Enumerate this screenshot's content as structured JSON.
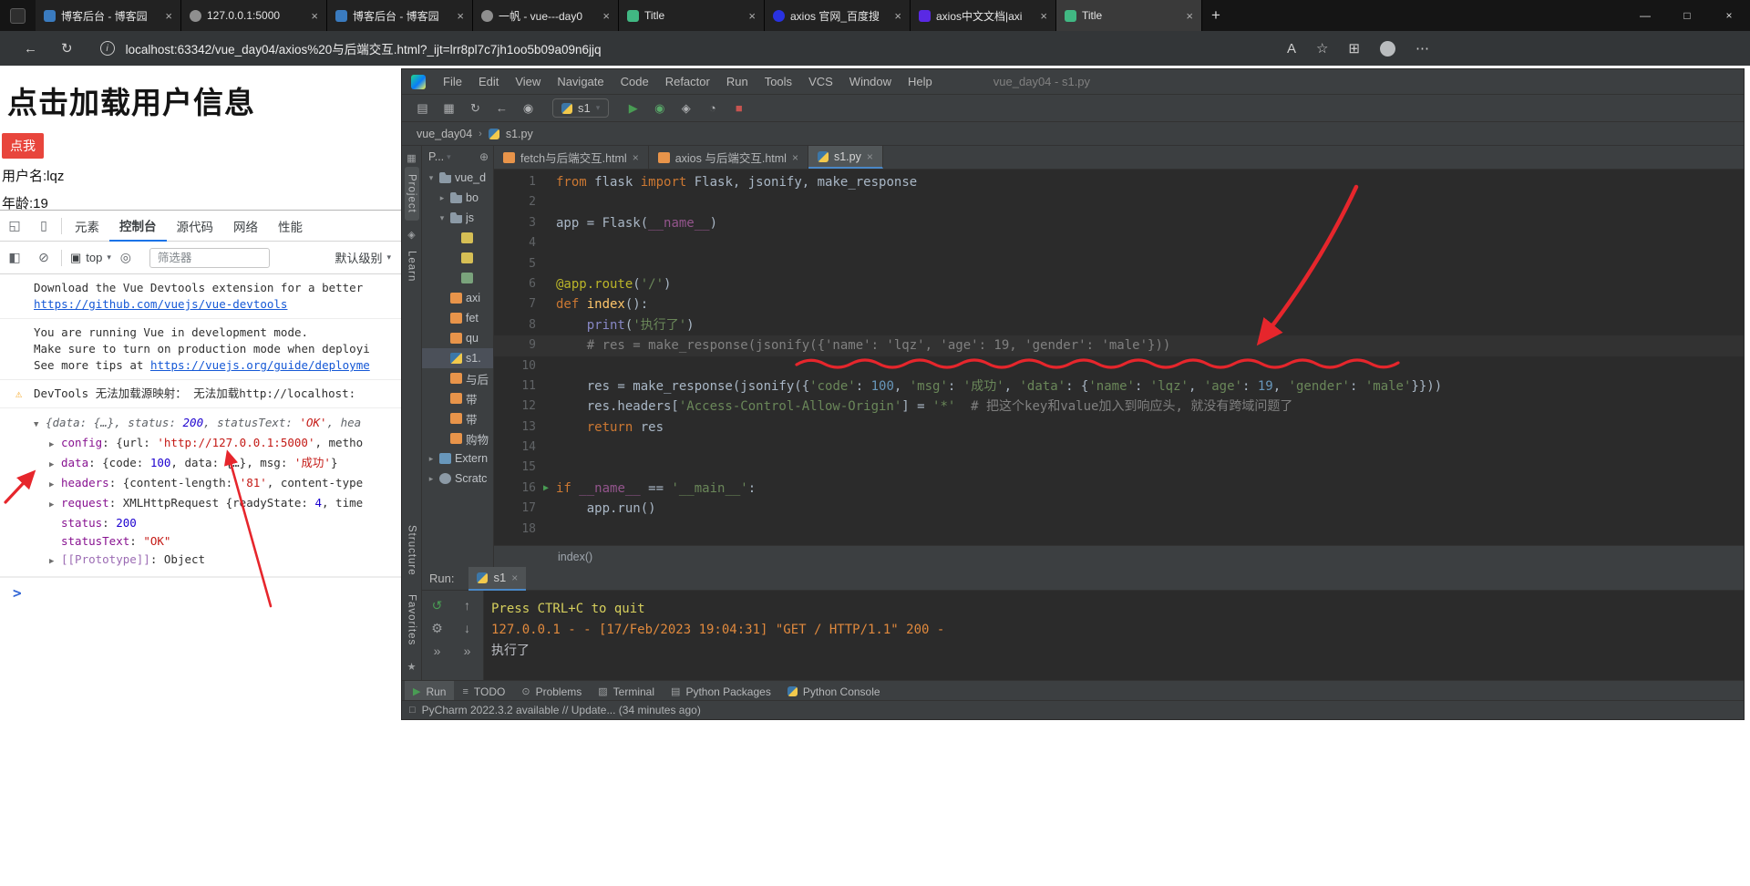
{
  "colors": {
    "annotation_red": "#e6262c",
    "button_red": "#e8453c",
    "devtools_accent": "#1a73e8",
    "run_green": "#499c54",
    "stop_red": "#c75450"
  },
  "icons": {
    "new_tab": "+",
    "minimize": "—",
    "maximize": "□",
    "close": "×",
    "close_small": "×",
    "back": "←",
    "refresh": "↻",
    "info": "i",
    "read_aloud": "A",
    "favorites": "☆",
    "collections": "⊞",
    "more": "⋯",
    "inspect": "◱",
    "device": "▯",
    "panel": "◧",
    "clear": "⊘",
    "frame": "▣",
    "eye": "◎",
    "caret": "▾",
    "chevron": "›",
    "target": "⊕",
    "open": "▤",
    "save": "▦",
    "sync": "↻",
    "user": "◉",
    "run": "▶",
    "debug": "◉",
    "coverage": "◈",
    "profiler": "◔",
    "stop": "■",
    "rerun": "↺",
    "up": "↑",
    "settings": "⚙",
    "down": "↓",
    "expand": "»",
    "todo": "≡",
    "problems": "⊙",
    "terminal": "▨",
    "packages": "▤",
    "status": "□",
    "warning": "⚠",
    "star": "★",
    "learn": "◈",
    "grid": "▦",
    "run_line": "▶"
  },
  "browser": {
    "tabs": [
      {
        "label": "博客后台 - 博客园",
        "icon": "cnblogs"
      },
      {
        "label": "127.0.0.1:5000",
        "icon": "generic"
      },
      {
        "label": "博客后台 - 博客园",
        "icon": "cnblogs"
      },
      {
        "label": "一帆 - vue---day0",
        "icon": "generic"
      },
      {
        "label": "Title",
        "icon": "vue"
      },
      {
        "label": "axios 官网_百度搜",
        "icon": "baidu"
      },
      {
        "label": "axios中文文档|axi",
        "icon": "axios"
      },
      {
        "label": "Title",
        "icon": "vue",
        "active": true
      }
    ],
    "window_controls": [
      "minimize",
      "maximize",
      "close"
    ],
    "address": {
      "url": "localhost:63342/vue_day04/axios%20与后端交互.html?_ijt=lrr8pl7c7jh1oo5b09a09n6jjq"
    }
  },
  "page": {
    "heading": "点击加载用户信息",
    "load_button": "点我",
    "username_line": "用户名:lqz",
    "age_line": "年龄:19"
  },
  "devtools": {
    "tabs": [
      {
        "label": "元素"
      },
      {
        "label": "控制台",
        "active": true
      },
      {
        "label": "源代码"
      },
      {
        "label": "网络"
      },
      {
        "label": "性能"
      }
    ],
    "context_selector": "top",
    "filter_placeholder": "筛选器",
    "log_level": "默认级别",
    "console": {
      "prompt": ">",
      "messages": [
        {
          "type": "log",
          "lines": [
            [
              [
                "pl",
                "Download the Vue Devtools extension for a better"
              ]
            ],
            [
              [
                "link",
                "https://github.com/vuejs/vue-devtools"
              ]
            ]
          ]
        },
        {
          "type": "log",
          "lines": [
            [
              [
                "pl",
                "You are running Vue in development mode."
              ]
            ],
            [
              [
                "pl",
                "Make sure to turn on production mode when deployi"
              ]
            ],
            [
              [
                "pl",
                "See more tips at "
              ],
              [
                "link",
                "https://vuejs.org/guide/deployme"
              ]
            ]
          ]
        },
        {
          "type": "warning",
          "lines": [
            [
              [
                "pl",
                "DevTools 无法加载源映射： 无法加载http://localhost:"
              ]
            ]
          ]
        },
        {
          "type": "tree",
          "rows": [
            {
              "a": "▼",
              "indent": 0,
              "tk": [
                [
                  "prev",
                  "{data: {…}, status: "
                ],
                [
                  "prevnum",
                  "200"
                ],
                [
                  "prev",
                  ", statusText: "
                ],
                [
                  "prevstr",
                  "'OK'"
                ],
                [
                  "prev",
                  ", hea"
                ]
              ]
            },
            {
              "a": "▶",
              "indent": 1,
              "tk": [
                [
                  "key",
                  "config"
                ],
                [
                  "pl",
                  ": {url: "
                ],
                [
                  "str",
                  "'http://127.0.0.1:5000'"
                ],
                [
                  "pl",
                  ", metho"
                ]
              ]
            },
            {
              "a": "▶",
              "indent": 1,
              "tk": [
                [
                  "key",
                  "data"
                ],
                [
                  "pl",
                  ": {code: "
                ],
                [
                  "num",
                  "100"
                ],
                [
                  "pl",
                  ", data: {…}, msg: "
                ],
                [
                  "str",
                  "'成功'"
                ],
                [
                  "pl",
                  "}"
                ]
              ]
            },
            {
              "a": "▶",
              "indent": 1,
              "tk": [
                [
                  "key",
                  "headers"
                ],
                [
                  "pl",
                  ": {content-length: "
                ],
                [
                  "str",
                  "'81'"
                ],
                [
                  "pl",
                  ", content-type"
                ]
              ]
            },
            {
              "a": "▶",
              "indent": 1,
              "tk": [
                [
                  "key",
                  "request"
                ],
                [
                  "pl",
                  ": XMLHttpRequest {readyState: "
                ],
                [
                  "num",
                  "4"
                ],
                [
                  "pl",
                  ", time"
                ]
              ]
            },
            {
              "a": "",
              "indent": 1,
              "tk": [
                [
                  "key",
                  "status"
                ],
                [
                  "pl",
                  ": "
                ],
                [
                  "num",
                  "200"
                ]
              ]
            },
            {
              "a": "",
              "indent": 1,
              "tk": [
                [
                  "key",
                  "statusText"
                ],
                [
                  "pl",
                  ": "
                ],
                [
                  "str",
                  "\"OK\""
                ]
              ]
            },
            {
              "a": "▶",
              "indent": 1,
              "tk": [
                [
                  "keydim",
                  "[[Prototype]]"
                ],
                [
                  "pl",
                  ": "
                ],
                [
                  "pl",
                  "Object"
                ]
              ]
            }
          ]
        }
      ]
    }
  },
  "pycharm": {
    "title": "vue_day04 - s1.py",
    "menus": [
      "File",
      "Edit",
      "View",
      "Navigate",
      "Code",
      "Refactor",
      "Run",
      "Tools",
      "VCS",
      "Window",
      "Help"
    ],
    "toolbar_left": [
      "open",
      "save",
      "sync",
      "back",
      "user"
    ],
    "toolbar_right": [
      "run",
      "debug",
      "coverage",
      "profiler",
      "stop"
    ],
    "run_config": "s1",
    "breadcrumbs": [
      "vue_day04",
      "s1.py"
    ],
    "tool_strip": [
      "Project",
      "Learn"
    ],
    "tool_strip_bottom": [
      "Structure",
      "Favorites"
    ],
    "project_panel": {
      "header": "P...",
      "items": [
        {
          "label": "vue_d",
          "indent": 0,
          "arrow": "▾",
          "icon": "folder"
        },
        {
          "label": "bo",
          "indent": 1,
          "arrow": "▸",
          "icon": "folder"
        },
        {
          "label": "js",
          "indent": 1,
          "arrow": "▾",
          "icon": "folder"
        },
        {
          "label": "",
          "indent": 2,
          "arrow": "",
          "icon": "js"
        },
        {
          "label": "",
          "indent": 2,
          "arrow": "",
          "icon": "js"
        },
        {
          "label": "",
          "indent": 2,
          "arrow": "",
          "icon": "img"
        },
        {
          "label": "axi",
          "indent": 1,
          "arrow": "",
          "icon": "html"
        },
        {
          "label": "fet",
          "indent": 1,
          "arrow": "",
          "icon": "html"
        },
        {
          "label": "qu",
          "indent": 1,
          "arrow": "",
          "icon": "html"
        },
        {
          "label": "s1.",
          "indent": 1,
          "arrow": "",
          "icon": "py",
          "selected": true
        },
        {
          "label": "与后",
          "indent": 1,
          "arrow": "",
          "icon": "html"
        },
        {
          "label": "带",
          "indent": 1,
          "arrow": "",
          "icon": "html"
        },
        {
          "label": "带",
          "indent": 1,
          "arrow": "",
          "icon": "html"
        },
        {
          "label": "购物",
          "indent": 1,
          "arrow": "",
          "icon": "html"
        },
        {
          "label": "Extern",
          "indent": 0,
          "arrow": "▸",
          "icon": "lib"
        },
        {
          "label": "Scratc",
          "indent": 0,
          "arrow": "▸",
          "icon": "scratch"
        }
      ]
    },
    "editor_tabs": [
      {
        "label": "fetch与后端交互.html",
        "icon": "html"
      },
      {
        "label": "axios 与后端交互.html",
        "icon": "html"
      },
      {
        "label": "s1.py",
        "icon": "py",
        "active": true
      }
    ],
    "code": [
      {
        "n": 1,
        "t": [
          [
            "kw",
            "from"
          ],
          [
            "pl",
            " flask "
          ],
          [
            "kw",
            "import"
          ],
          [
            "pl",
            " Flask, jsonify, make_response"
          ]
        ]
      },
      {
        "n": 2,
        "t": []
      },
      {
        "n": 3,
        "t": [
          [
            "pl",
            "app = Flask("
          ],
          [
            "dn",
            "__name__"
          ],
          [
            "pl",
            ")"
          ]
        ]
      },
      {
        "n": 4,
        "t": []
      },
      {
        "n": 5,
        "t": []
      },
      {
        "n": 6,
        "t": [
          [
            "dec",
            "@app.route"
          ],
          [
            "pl",
            "("
          ],
          [
            "str",
            "'/'"
          ],
          [
            "pl",
            ")"
          ]
        ]
      },
      {
        "n": 7,
        "t": [
          [
            "kw",
            "def "
          ],
          [
            "fn",
            "index"
          ],
          [
            "pl",
            "():"
          ]
        ]
      },
      {
        "n": 8,
        "t": [
          [
            "pl",
            "    "
          ],
          [
            "bi",
            "print"
          ],
          [
            "pl",
            "("
          ],
          [
            "str",
            "'执行了'"
          ],
          [
            "pl",
            ")"
          ]
        ]
      },
      {
        "n": 9,
        "current": true,
        "t": [
          [
            "cm",
            "    # res = make_response(jsonify({'name': 'lqz', 'age': 19, 'gender': 'male'}))"
          ]
        ]
      },
      {
        "n": 10,
        "t": []
      },
      {
        "n": 11,
        "t": [
          [
            "pl",
            "    res = make_response(jsonify({"
          ],
          [
            "str",
            "'code'"
          ],
          [
            "pl",
            ": "
          ],
          [
            "num",
            "100"
          ],
          [
            "pl",
            ", "
          ],
          [
            "str",
            "'msg'"
          ],
          [
            "pl",
            ": "
          ],
          [
            "str",
            "'成功'"
          ],
          [
            "pl",
            ", "
          ],
          [
            "str",
            "'data'"
          ],
          [
            "pl",
            ": {"
          ],
          [
            "str",
            "'name'"
          ],
          [
            "pl",
            ": "
          ],
          [
            "str",
            "'lqz'"
          ],
          [
            "pl",
            ", "
          ],
          [
            "str",
            "'age'"
          ],
          [
            "pl",
            ": "
          ],
          [
            "num",
            "19"
          ],
          [
            "pl",
            ", "
          ],
          [
            "str",
            "'gender'"
          ],
          [
            "pl",
            ": "
          ],
          [
            "str",
            "'male'"
          ],
          [
            "pl",
            "}}))"
          ]
        ]
      },
      {
        "n": 12,
        "t": [
          [
            "pl",
            "    res.headers["
          ],
          [
            "str",
            "'Access-Control-Allow-Origin'"
          ],
          [
            "pl",
            "] = "
          ],
          [
            "str",
            "'*'"
          ],
          [
            "pl",
            "  "
          ],
          [
            "cm",
            "# 把这个key和value加入到响应头, 就没有跨域问题了"
          ]
        ]
      },
      {
        "n": 13,
        "t": [
          [
            "pl",
            "    "
          ],
          [
            "kw",
            "return"
          ],
          [
            "pl",
            " res"
          ]
        ]
      },
      {
        "n": 14,
        "t": []
      },
      {
        "n": 15,
        "t": []
      },
      {
        "n": 16,
        "run": true,
        "t": [
          [
            "kw",
            "if "
          ],
          [
            "dn",
            "__name__"
          ],
          [
            "pl",
            " == "
          ],
          [
            "str",
            "'__main__'"
          ],
          [
            "pl",
            ":"
          ]
        ]
      },
      {
        "n": 17,
        "t": [
          [
            "pl",
            "    app.run()"
          ]
        ]
      },
      {
        "n": 18,
        "t": []
      }
    ],
    "breadcrumb_bottom": "index()",
    "run_panel": {
      "label": "Run:",
      "tab": "s1",
      "output": [
        {
          "c": "y",
          "t": "Press CTRL+C to quit"
        },
        {
          "c": "o",
          "t": "127.0.0.1 - - [17/Feb/2023 19:04:31] \"GET / HTTP/1.1\" 200 -"
        },
        {
          "c": "w",
          "t": "执行了"
        }
      ]
    },
    "run_strip": [
      "rerun",
      "up",
      "settings",
      "down",
      "expand",
      "expand"
    ],
    "bottom_tools": [
      {
        "label": "Run",
        "icon": "run",
        "active": true
      },
      {
        "label": "TODO",
        "icon": "todo"
      },
      {
        "label": "Problems",
        "icon": "problems"
      },
      {
        "label": "Terminal",
        "icon": "terminal"
      },
      {
        "label": "Python Packages",
        "icon": "packages"
      },
      {
        "label": "Python Console",
        "icon": "pyconsole"
      }
    ],
    "status_bar": "PyCharm 2022.3.2 available // Update... (34 minutes ago)"
  }
}
